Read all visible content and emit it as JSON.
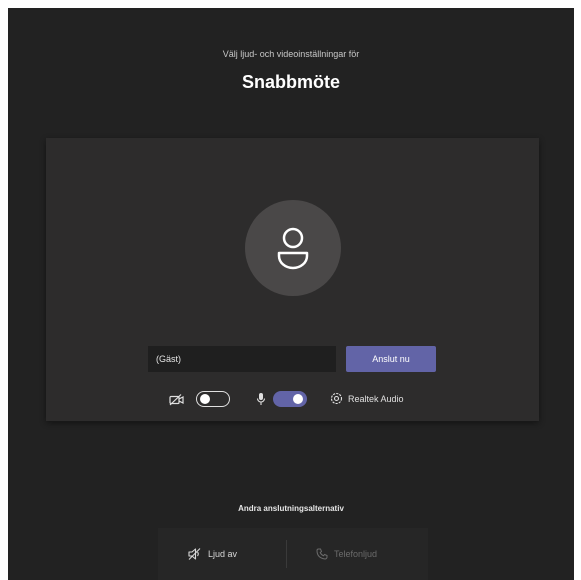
{
  "header": {
    "subtitle": "Välj ljud- och videoinställningar för",
    "title": "Snabbmöte"
  },
  "join_form": {
    "name_value": "(Gäst)",
    "join_label": "Anslut nu"
  },
  "controls": {
    "camera_enabled": false,
    "mic_enabled": true,
    "audio_device": "Realtek Audio"
  },
  "alternatives": {
    "title": "Andra anslutningsalternativ",
    "audio_off_label": "Ljud av",
    "phone_audio_label": "Telefonljud"
  },
  "colors": {
    "accent": "#6264a7",
    "background": "#222222",
    "panel": "#2d2c2c"
  },
  "icons": [
    "camera-off-icon",
    "microphone-icon",
    "gear-icon",
    "person-icon",
    "speaker-off-icon",
    "phone-icon"
  ]
}
